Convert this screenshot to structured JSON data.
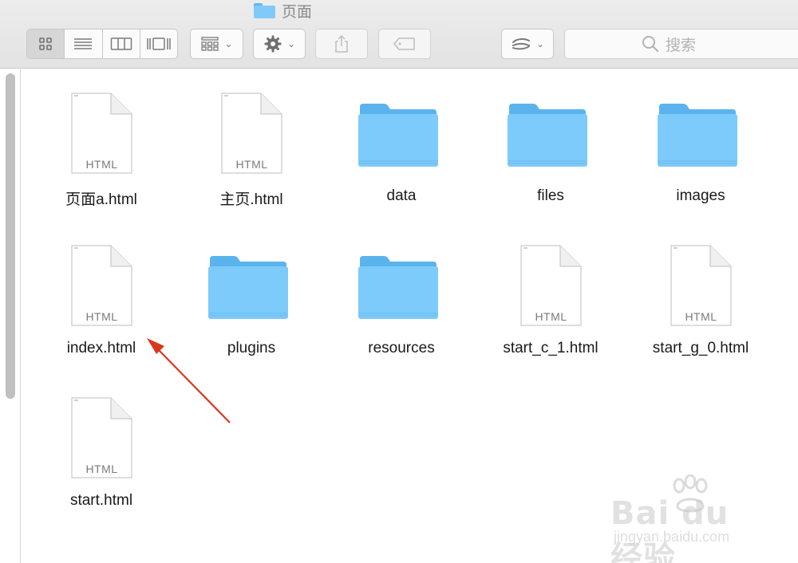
{
  "window": {
    "title": "页面"
  },
  "toolbar": {
    "view_modes": [
      {
        "name": "icon-view",
        "active": true
      },
      {
        "name": "list-view",
        "active": false
      },
      {
        "name": "column-view",
        "active": false
      },
      {
        "name": "gallery-view",
        "active": false
      }
    ],
    "search_placeholder": "搜索"
  },
  "files": [
    {
      "name": "页面a.html",
      "kind": "html",
      "icon_text": "HTML"
    },
    {
      "name": "主页.html",
      "kind": "html",
      "icon_text": "HTML"
    },
    {
      "name": "data",
      "kind": "folder"
    },
    {
      "name": "files",
      "kind": "folder"
    },
    {
      "name": "images",
      "kind": "folder"
    },
    {
      "name": "index.html",
      "kind": "html",
      "icon_text": "HTML"
    },
    {
      "name": "plugins",
      "kind": "folder"
    },
    {
      "name": "resources",
      "kind": "folder"
    },
    {
      "name": "start_c_1.html",
      "kind": "html",
      "icon_text": "HTML"
    },
    {
      "name": "start_g_0.html",
      "kind": "html",
      "icon_text": "HTML"
    },
    {
      "name": "start.html",
      "kind": "html",
      "icon_text": "HTML"
    }
  ],
  "annotation": {
    "color": "#d9371d"
  },
  "watermark": {
    "logo": "Bai du 经验",
    "url": "jingyan.baidu.com"
  }
}
